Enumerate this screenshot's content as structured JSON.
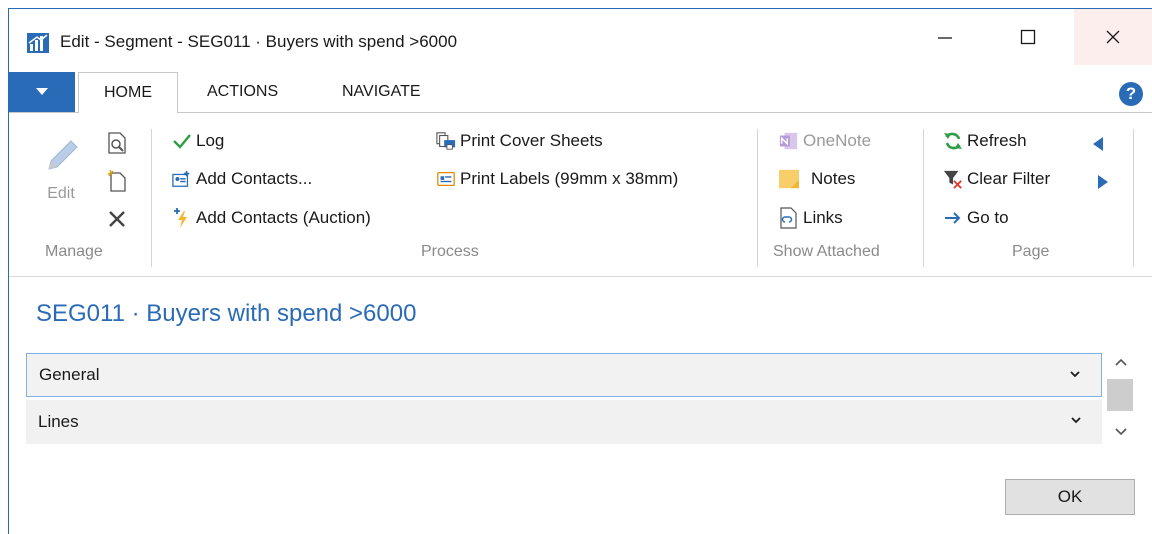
{
  "window": {
    "title": "Edit - Segment - SEG011 · Buyers with spend >6000",
    "minimize_icon": "minimize-icon",
    "maximize_icon": "maximize-icon",
    "close_icon": "close-icon"
  },
  "tabs": {
    "home": "HOME",
    "actions": "ACTIONS",
    "navigate": "NAVIGATE",
    "help": "?"
  },
  "ribbon": {
    "manage": {
      "label": "Manage",
      "edit": "Edit"
    },
    "process": {
      "label": "Process",
      "log": "Log",
      "add_contacts": "Add Contacts...",
      "add_contacts_auction": "Add Contacts (Auction)",
      "print_cover_sheets": "Print Cover Sheets",
      "print_labels": "Print Labels (99mm x 38mm)"
    },
    "show_attached": {
      "label": "Show Attached",
      "onenote": "OneNote",
      "notes": "Notes",
      "links": "Links"
    },
    "page": {
      "label": "Page",
      "refresh": "Refresh",
      "clear_filter": "Clear Filter",
      "go_to": "Go to"
    }
  },
  "content": {
    "page_title": "SEG011 · Buyers with spend >6000",
    "fasttabs": [
      {
        "label": "General"
      },
      {
        "label": "Lines"
      }
    ],
    "ok_label": "OK"
  },
  "colors": {
    "accent": "#2a6bb7",
    "close_hover": "#fdeeee",
    "disabled_text": "#9a9a9a"
  }
}
